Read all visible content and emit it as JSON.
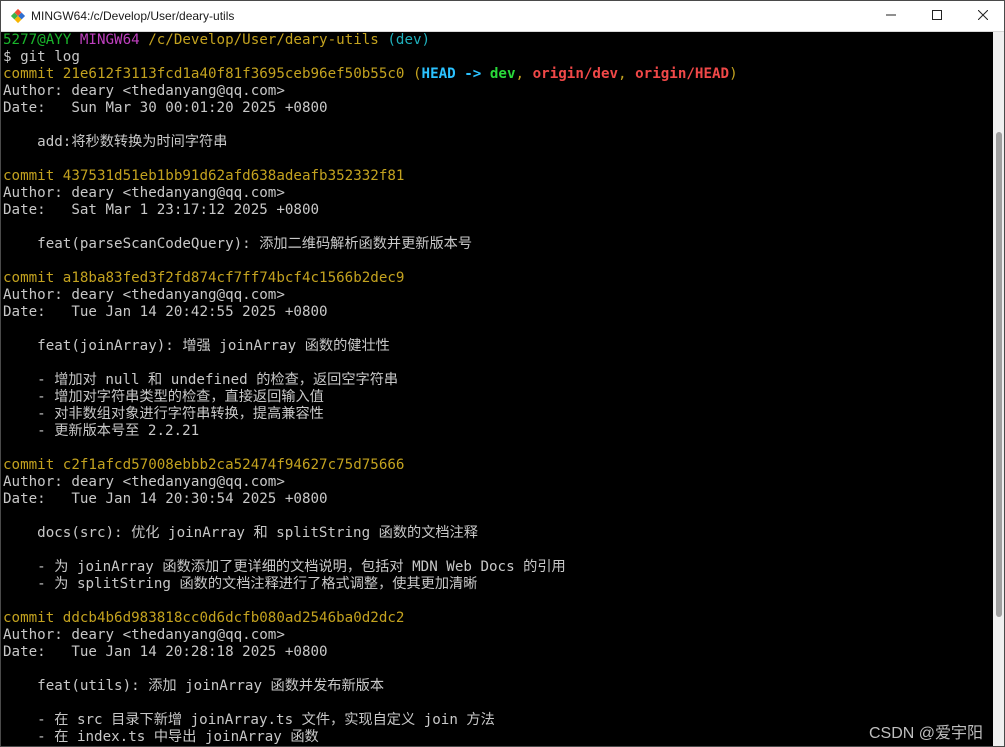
{
  "window": {
    "title": "MINGW64:/c/Develop/User/deary-utils",
    "icon": "git-bash-icon",
    "controls": [
      "minimize-icon",
      "maximize-icon",
      "close-icon"
    ]
  },
  "terminal": {
    "lines": [
      [
        {
          "t": "5277@AYY ",
          "c": "green"
        },
        {
          "t": "MINGW64 ",
          "c": "purple"
        },
        {
          "t": "/c/Develop/User/deary-utils",
          "c": "yellow"
        },
        {
          "t": " (dev)",
          "c": "cyan"
        }
      ],
      [
        {
          "t": "$ git log",
          "c": "gray"
        }
      ],
      [
        {
          "t": "commit 21e612f3113fcd1a40f81f3695ceb96ef50b55c0 ",
          "c": "dec"
        },
        {
          "t": "(",
          "c": "dec"
        },
        {
          "t": "HEAD -> ",
          "c": "head"
        },
        {
          "t": "dev",
          "c": "branch"
        },
        {
          "t": ", ",
          "c": "dec"
        },
        {
          "t": "origin/dev",
          "c": "remote"
        },
        {
          "t": ", ",
          "c": "dec"
        },
        {
          "t": "origin/HEAD",
          "c": "remote"
        },
        {
          "t": ")",
          "c": "dec"
        }
      ],
      [
        {
          "t": "Author: deary <thedanyang@qq.com>",
          "c": "gray"
        }
      ],
      [
        {
          "t": "Date:   Sun Mar 30 00:01:20 2025 +0800",
          "c": "gray"
        }
      ],
      [],
      [
        {
          "t": "    add:将秒数转换为时间字符串",
          "c": "gray"
        }
      ],
      [],
      [
        {
          "t": "commit 437531d51eb1bb91d62afd638adeafb352332f81",
          "c": "dec"
        }
      ],
      [
        {
          "t": "Author: deary <thedanyang@qq.com>",
          "c": "gray"
        }
      ],
      [
        {
          "t": "Date:   Sat Mar 1 23:17:12 2025 +0800",
          "c": "gray"
        }
      ],
      [],
      [
        {
          "t": "    feat(parseScanCodeQuery): 添加二维码解析函数并更新版本号",
          "c": "gray"
        }
      ],
      [],
      [
        {
          "t": "commit a18ba83fed3f2fd874cf7ff74bcf4c1566b2dec9",
          "c": "dec"
        }
      ],
      [
        {
          "t": "Author: deary <thedanyang@qq.com>",
          "c": "gray"
        }
      ],
      [
        {
          "t": "Date:   Tue Jan 14 20:42:55 2025 +0800",
          "c": "gray"
        }
      ],
      [],
      [
        {
          "t": "    feat(joinArray): 增强 joinArray 函数的健壮性",
          "c": "gray"
        }
      ],
      [],
      [
        {
          "t": "    - 增加对 null 和 undefined 的检查，返回空字符串",
          "c": "gray"
        }
      ],
      [
        {
          "t": "    - 增加对字符串类型的检查，直接返回输入值",
          "c": "gray"
        }
      ],
      [
        {
          "t": "    - 对非数组对象进行字符串转换，提高兼容性",
          "c": "gray"
        }
      ],
      [
        {
          "t": "    - 更新版本号至 2.2.21",
          "c": "gray"
        }
      ],
      [],
      [
        {
          "t": "commit c2f1afcd57008ebbb2ca52474f94627c75d75666",
          "c": "dec"
        }
      ],
      [
        {
          "t": "Author: deary <thedanyang@qq.com>",
          "c": "gray"
        }
      ],
      [
        {
          "t": "Date:   Tue Jan 14 20:30:54 2025 +0800",
          "c": "gray"
        }
      ],
      [],
      [
        {
          "t": "    docs(src): 优化 joinArray 和 splitString 函数的文档注释",
          "c": "gray"
        }
      ],
      [],
      [
        {
          "t": "    - 为 joinArray 函数添加了更详细的文档说明，包括对 MDN Web Docs 的引用",
          "c": "gray"
        }
      ],
      [
        {
          "t": "    - 为 splitString 函数的文档注释进行了格式调整，使其更加清晰",
          "c": "gray"
        }
      ],
      [],
      [
        {
          "t": "commit ddcb4b6d983818cc0d6dcfb080ad2546ba0d2dc2",
          "c": "dec"
        }
      ],
      [
        {
          "t": "Author: deary <thedanyang@qq.com>",
          "c": "gray"
        }
      ],
      [
        {
          "t": "Date:   Tue Jan 14 20:28:18 2025 +0800",
          "c": "gray"
        }
      ],
      [],
      [
        {
          "t": "    feat(utils): 添加 joinArray 函数并发布新版本",
          "c": "gray"
        }
      ],
      [],
      [
        {
          "t": "    - 在 src 目录下新增 joinArray.ts 文件，实现自定义 join 方法",
          "c": "gray"
        }
      ],
      [
        {
          "t": "    - 在 index.ts 中导出 joinArray 函数",
          "c": "gray"
        }
      ]
    ]
  },
  "watermark": "CSDN @爱宇阳"
}
